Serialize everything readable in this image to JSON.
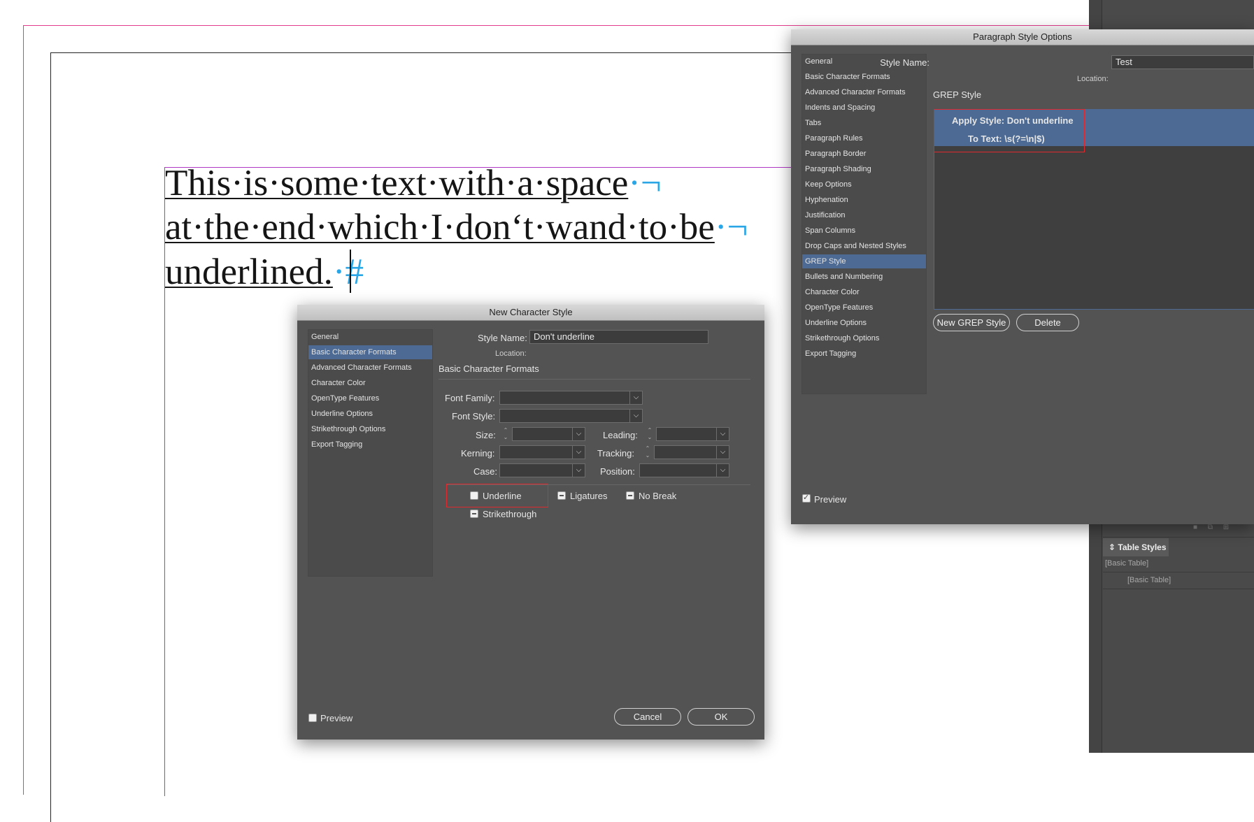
{
  "document": {
    "lines": [
      {
        "text": "This·is·some·text·with·a·space",
        "mark": "·¬"
      },
      {
        "text": "at·the·end·which·I·don‘t·wand·to·be",
        "mark": "·¬"
      },
      {
        "text": "underlined.",
        "mark": "·#"
      }
    ]
  },
  "paragraph_dialog": {
    "title": "Paragraph Style Options",
    "style_name_label": "Style Name:",
    "style_name_value": "Test",
    "location_label": "Location:",
    "section_title": "GREP Style",
    "sidebar": [
      "General",
      "Basic Character Formats",
      "Advanced Character Formats",
      "Indents and Spacing",
      "Tabs",
      "Paragraph Rules",
      "Paragraph Border",
      "Paragraph Shading",
      "Keep Options",
      "Hyphenation",
      "Justification",
      "Span Columns",
      "Drop Caps and Nested Styles",
      "GREP Style",
      "Bullets and Numbering",
      "Character Color",
      "OpenType Features",
      "Underline Options",
      "Strikethrough Options",
      "Export Tagging"
    ],
    "selected_index": 13,
    "grep_apply": "Apply Style: Don't underline",
    "grep_to_text": "To Text: \\s(?=\\n|$)",
    "new_grep_button": "New GREP Style",
    "delete_button": "Delete",
    "preview_label": "Preview"
  },
  "char_dialog": {
    "title": "New Character Style",
    "style_name_label": "Style Name:",
    "style_name_value": "Don't underline",
    "location_label": "Location:",
    "section_title": "Basic Character Formats",
    "sidebar": [
      "General",
      "Basic Character Formats",
      "Advanced Character Formats",
      "Character Color",
      "OpenType Features",
      "Underline Options",
      "Strikethrough Options",
      "Export Tagging"
    ],
    "selected_index": 1,
    "font_family_label": "Font Family:",
    "font_style_label": "Font Style:",
    "size_label": "Size:",
    "leading_label": "Leading:",
    "kerning_label": "Kerning:",
    "tracking_label": "Tracking:",
    "case_label": "Case:",
    "position_label": "Position:",
    "underline_label": "Underline",
    "ligatures_label": "Ligatures",
    "nobreak_label": "No Break",
    "strikethrough_label": "Strikethrough",
    "preview_label": "Preview",
    "cancel_button": "Cancel",
    "ok_button": "OK"
  },
  "panel": {
    "table_styles_tab": "Table Styles",
    "row1": "[Basic Table]",
    "row2": "[Basic Table]"
  },
  "colors": {
    "selection": "#4c6a93",
    "highlight_box": "#e0282f",
    "bleed": "#e23a8c",
    "frame": "#b036c4",
    "hidden_chars": "#2aa6e6"
  }
}
